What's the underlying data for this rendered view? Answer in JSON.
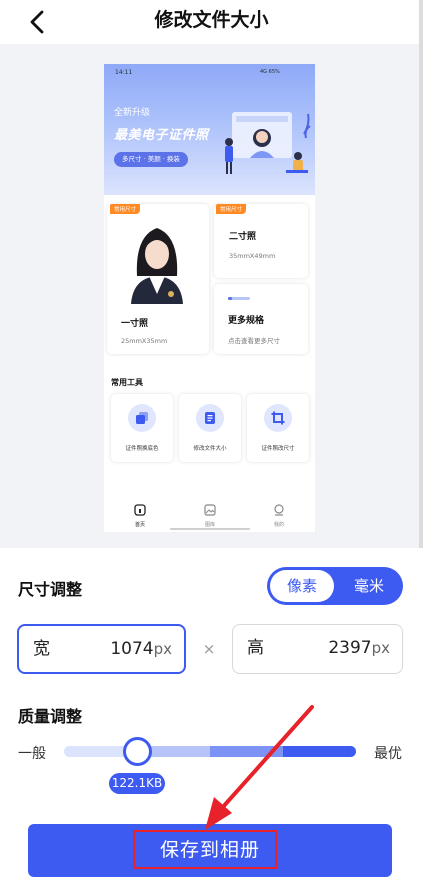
{
  "header": {
    "title": "修改文件大小"
  },
  "preview": {
    "status_bar": {
      "time": "14:11",
      "right": "4G 65%"
    },
    "banner": {
      "line1": "全新升级",
      "line2": "最美电子证件照",
      "pill": "多尺寸 · 美颜 · 换装"
    },
    "cards": [
      {
        "tag": "常用尺寸",
        "name": "一寸照",
        "size": "25mmX35mm"
      },
      {
        "tag": "常用尺寸",
        "name": "二寸照",
        "size": "35mmX49mm"
      },
      {
        "name": "更多规格",
        "desc": "点击查看更多尺寸"
      }
    ],
    "tools_title": "常用工具",
    "tools": [
      {
        "label": "证件照换底色",
        "icon": "layers-icon"
      },
      {
        "label": "修改文件大小",
        "icon": "document-icon"
      },
      {
        "label": "证件照改尺寸",
        "icon": "crop-icon"
      }
    ],
    "nav": [
      {
        "label": "首页",
        "icon": "home-icon"
      },
      {
        "label": "图库",
        "icon": "image-icon"
      },
      {
        "label": "我的",
        "icon": "profile-icon"
      }
    ]
  },
  "size_adjust": {
    "title": "尺寸调整",
    "unit_options": [
      "像素",
      "毫米"
    ],
    "selected_unit": "像素",
    "width": {
      "label": "宽",
      "value": "1074",
      "unit": "px"
    },
    "times": "×",
    "height": {
      "label": "高",
      "value": "2397",
      "unit": "px"
    }
  },
  "quality_adjust": {
    "title": "质量调整",
    "min_label": "一般",
    "max_label": "最优",
    "level": 0.25,
    "file_size": "122.1KB"
  },
  "save_button": {
    "label": "保存到相册"
  },
  "colors": {
    "accent": "#3d5af1",
    "highlight": "#e8222a",
    "tag": "#ff8a24"
  }
}
